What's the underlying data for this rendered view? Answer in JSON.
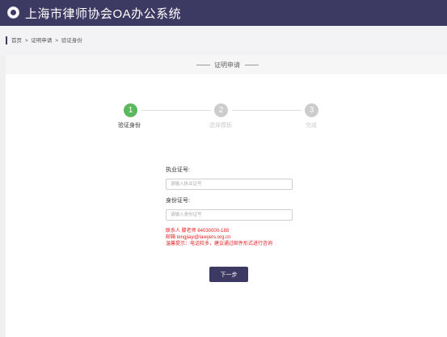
{
  "header": {
    "title": "上海市律师协会OA办公系统",
    "logo_icon": "association-seal-icon",
    "background_color": "#3c3a63"
  },
  "breadcrumb": {
    "items": [
      "首页",
      "证明申请",
      "验证身份"
    ],
    "separator": ">"
  },
  "panel": {
    "title": "证明申请"
  },
  "steps": [
    {
      "number": "1",
      "label": "验证身份",
      "active": true
    },
    {
      "number": "2",
      "label": "选择模板",
      "active": false
    },
    {
      "number": "3",
      "label": "完成",
      "active": false
    }
  ],
  "form": {
    "license": {
      "label": "执业证号:",
      "placeholder": "请输入执业证号",
      "value": ""
    },
    "id_card": {
      "label": "身份证号:",
      "placeholder": "请输入身份证号",
      "value": ""
    }
  },
  "contact": {
    "person": "联系人  滕老师  64030000-188",
    "email": "邮箱   tengjiayi@lawyers.org.cn",
    "tip": "温馨提示：电话较多，建议通过邮件形式进行咨询",
    "color": "#e02020"
  },
  "actions": {
    "next_label": "下一步"
  },
  "colors": {
    "accent": "#3c3a63",
    "step_active": "#5cb85c",
    "step_inactive": "#cccccc"
  }
}
